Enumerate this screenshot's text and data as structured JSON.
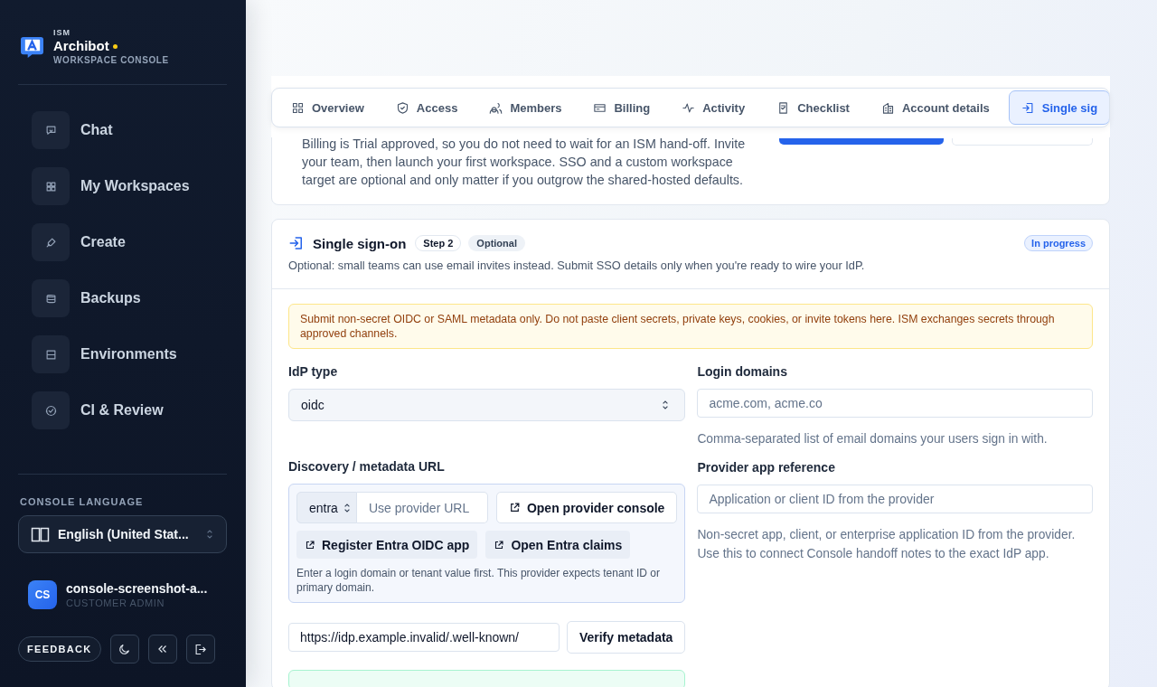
{
  "sidebar": {
    "brand": {
      "org": "ISM",
      "name": "Archibot",
      "subtitle": "WORKSPACE CONSOLE"
    },
    "nav": [
      {
        "label": "Chat"
      },
      {
        "label": "My Workspaces"
      },
      {
        "label": "Create"
      },
      {
        "label": "Backups"
      },
      {
        "label": "Environments"
      },
      {
        "label": "CI & Review"
      }
    ],
    "language": {
      "label": "CONSOLE LANGUAGE",
      "value": "English (United Stat..."
    },
    "user": {
      "initials": "CS",
      "name": "console-screenshot-a...",
      "role": "CUSTOMER ADMIN"
    },
    "feedback": "FEEDBACK"
  },
  "tabs": [
    {
      "label": "Overview",
      "selected": false
    },
    {
      "label": "Access",
      "selected": false
    },
    {
      "label": "Members",
      "selected": false
    },
    {
      "label": "Billing",
      "selected": false
    },
    {
      "label": "Activity",
      "selected": false
    },
    {
      "label": "Checklist",
      "selected": false
    },
    {
      "label": "Account details",
      "selected": false
    },
    {
      "label": "Single sig",
      "selected": true
    }
  ],
  "intro_card": {
    "text": "Billing is Trial approved, so you do not need to wait for an ISM hand-off. Invite your team, then launch your first workspace. SSO and a custom workspace target are optional and only matter if you outgrow the shared-hosted defaults."
  },
  "sso": {
    "title": "Single sign-on",
    "step": "Step 2",
    "optional": "Optional",
    "status": "In progress",
    "subtitle": "Optional: small teams can use email invites instead. Submit SSO details only when you're ready to wire your IdP.",
    "warning": "Submit non-secret OIDC or SAML metadata only. Do not paste client secrets, private keys, cookies, or invite tokens here. ISM exchanges secrets through approved channels.",
    "idp_type": {
      "label": "IdP type",
      "value": "oidc"
    },
    "login_domains": {
      "label": "Login domains",
      "placeholder": "acme.com, acme.co",
      "help": "Comma-separated list of email domains your users sign in with."
    },
    "discovery": {
      "label": "Discovery / metadata URL",
      "provider": "entra",
      "provider_url_placeholder": "Use provider URL",
      "open_console": "Open provider console",
      "links": [
        "Register Entra OIDC app",
        "Open Entra claims"
      ],
      "help": "Enter a login domain or tenant value first. This provider expects tenant ID or primary domain.",
      "url_value": "https://idp.example.invalid/.well-known/",
      "verify": "Verify metadata"
    },
    "app_reference": {
      "label": "Provider app reference",
      "placeholder": "Application or client ID from the provider",
      "help": "Non-secret app, client, or enterprise application ID from the provider. Use this to connect Console handoff notes to the exact IdP app."
    }
  }
}
